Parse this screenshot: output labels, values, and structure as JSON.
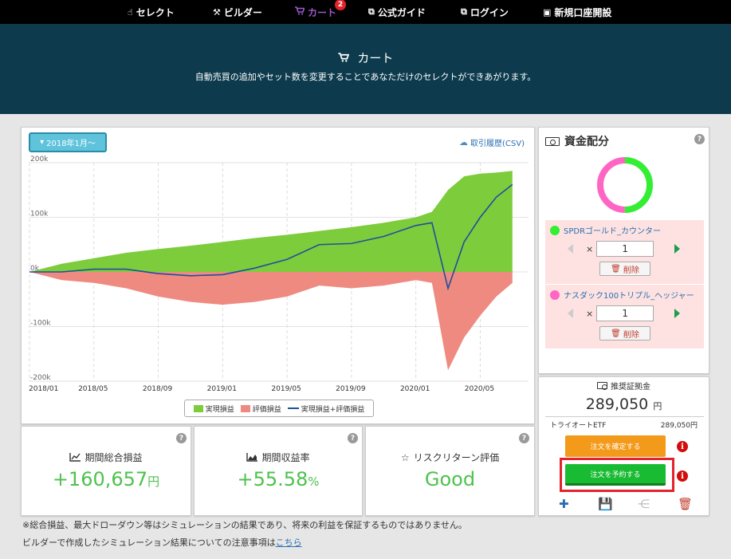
{
  "nav": {
    "items": [
      {
        "label": "セレクト",
        "icon": "hand-icon"
      },
      {
        "label": "ビルダー",
        "icon": "hammer-icon"
      },
      {
        "label": "カート",
        "icon": "cart-icon",
        "badge": "2"
      },
      {
        "label": "公式ガイド",
        "icon": "external-link-icon"
      },
      {
        "label": "ログイン",
        "icon": "external-link-icon"
      },
      {
        "label": "新規口座開設",
        "icon": "monitor-icon"
      }
    ],
    "active_color": "#9b59d0"
  },
  "header": {
    "title": "カート",
    "subtitle": "自動売買の追加やセット数を変更することであなただけのセレクトができあがります。",
    "bg_color": "#0d3b4d"
  },
  "chart_panel": {
    "period_button": "2018年1月～",
    "csv_link": "取引履歴(CSV)"
  },
  "chart_data": {
    "type": "area",
    "x_tick_labels": [
      "2018/01",
      "2018/05",
      "2018/09",
      "2019/01",
      "2019/05",
      "2019/09",
      "2020/01",
      "2020/05"
    ],
    "y_tick_labels": [
      "200k",
      "100k",
      "0k",
      "-100k",
      "-200k"
    ],
    "ylim": [
      -200000,
      200000
    ],
    "grid": true,
    "legend_position": "bottom",
    "series": [
      {
        "name": "実現損益",
        "type": "area",
        "color": "#7dcc3c",
        "x": [
          "2018/01",
          "2018/03",
          "2018/05",
          "2018/07",
          "2018/09",
          "2018/11",
          "2019/01",
          "2019/03",
          "2019/05",
          "2019/07",
          "2019/09",
          "2019/11",
          "2020/01",
          "2020/02",
          "2020/03",
          "2020/04",
          "2020/05",
          "2020/06",
          "2020/07"
        ],
        "values": [
          0,
          15000,
          25000,
          35000,
          42000,
          48000,
          55000,
          62000,
          68000,
          75000,
          82000,
          90000,
          100000,
          110000,
          150000,
          175000,
          180000,
          182000,
          185000
        ]
      },
      {
        "name": "評価損益",
        "type": "area",
        "color": "#ef8a80",
        "x": [
          "2018/01",
          "2018/03",
          "2018/05",
          "2018/07",
          "2018/09",
          "2018/11",
          "2019/01",
          "2019/03",
          "2019/05",
          "2019/07",
          "2019/09",
          "2019/11",
          "2020/01",
          "2020/02",
          "2020/03",
          "2020/04",
          "2020/05",
          "2020/06",
          "2020/07"
        ],
        "values": [
          0,
          -15000,
          -20000,
          -30000,
          -45000,
          -55000,
          -60000,
          -55000,
          -45000,
          -25000,
          -30000,
          -25000,
          -15000,
          -20000,
          -180000,
          -120000,
          -80000,
          -45000,
          -20000
        ]
      },
      {
        "name": "実現損益+評価損益",
        "type": "line",
        "color": "#1e4f9c",
        "x": [
          "2018/01",
          "2018/03",
          "2018/05",
          "2018/07",
          "2018/09",
          "2018/11",
          "2019/01",
          "2019/03",
          "2019/05",
          "2019/07",
          "2019/09",
          "2019/11",
          "2020/01",
          "2020/02",
          "2020/03",
          "2020/04",
          "2020/05",
          "2020/06",
          "2020/07"
        ],
        "values": [
          0,
          0,
          5000,
          5000,
          -3000,
          -7000,
          -5000,
          7000,
          23000,
          50000,
          52000,
          65000,
          85000,
          90000,
          -30000,
          55000,
          100000,
          137000,
          160000
        ]
      }
    ]
  },
  "allocation": {
    "title": "資金配分",
    "items": [
      {
        "name": "SPDRゴールド_カウンター",
        "color": "#33ee33",
        "qty": "1",
        "delete_label": "削除"
      },
      {
        "name": "ナスダック100トリプル_ヘッジャー",
        "color": "#ff66c4",
        "qty": "1",
        "delete_label": "削除"
      }
    ],
    "qty_sep": "×",
    "donut_colors": [
      "#33ee33",
      "#ff66c4"
    ]
  },
  "margin": {
    "title": "推奨証拠金",
    "amount": "289,050",
    "unit": "円",
    "etf_label": "トライオートETF",
    "etf_value": "289,050円",
    "confirm_button": "注文を確定する",
    "reserve_button": "注文を予約する",
    "info_glyph": "i"
  },
  "stats": [
    {
      "label": "期間総合損益",
      "value": "+160,657",
      "unit": "円",
      "icon": "line-chart-icon"
    },
    {
      "label": "期間収益率",
      "value": "+55.58",
      "unit": "%",
      "icon": "area-chart-icon"
    },
    {
      "label": "リスクリターン評価",
      "value": "Good",
      "unit": "",
      "icon": "star-half-icon"
    }
  ],
  "footnotes": {
    "line1": "※総合損益、最大ドローダウン等はシミュレーションの結果であり、将来の利益を保証するものではありません。",
    "line2_prefix": "ビルダーで作成したシミュレーション結果についての注意事項は",
    "line2_link": "こちら"
  }
}
